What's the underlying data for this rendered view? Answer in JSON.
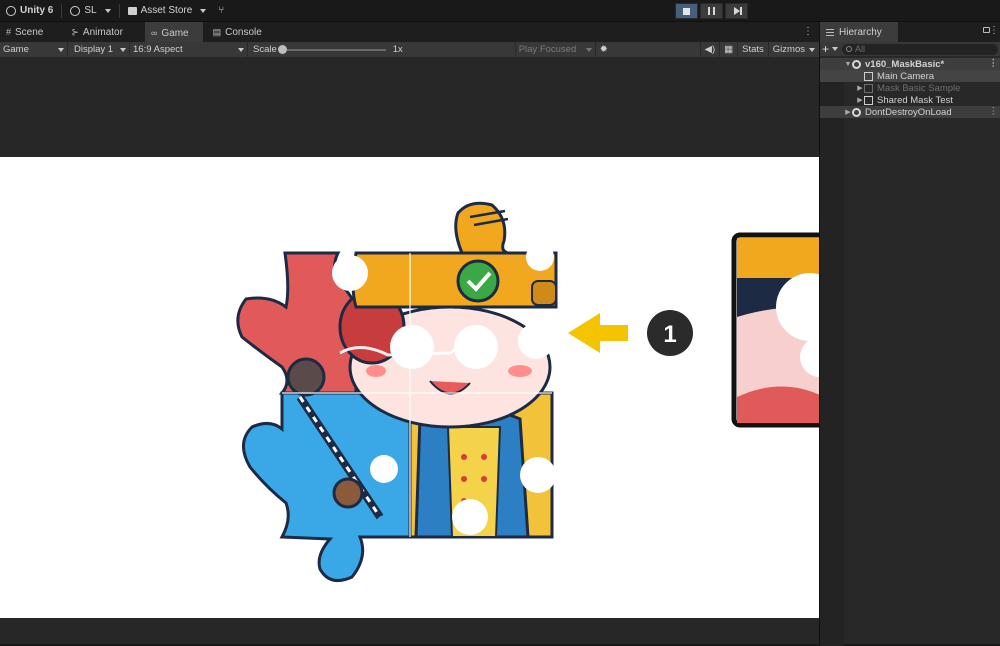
{
  "topbar": {
    "app_name": "Unity 6",
    "account": "SL",
    "asset_store": "Asset Store"
  },
  "tabs": [
    "Scene",
    "Animator",
    "Game",
    "Console"
  ],
  "gamebar": {
    "view_mode": "Game",
    "display": "Display 1",
    "aspect": "16:9 Aspect",
    "scale_label": "Scale",
    "scale_value": "1x",
    "play_focused": "Play Focused",
    "stats": "Stats",
    "gizmos": "Gizmos"
  },
  "callout": {
    "number": "1"
  },
  "hierarchy": {
    "tab_label": "Hierarchy",
    "search_placeholder": "All",
    "items": [
      {
        "label": "v160_MaskBasic*",
        "kind": "scene"
      },
      {
        "label": "Main Camera",
        "kind": "object",
        "selected": true
      },
      {
        "label": "Mask Basic Sample",
        "kind": "object",
        "disabled": true
      },
      {
        "label": "Shared Mask Test",
        "kind": "object"
      },
      {
        "label": "DontDestroyOnLoad",
        "kind": "scene"
      }
    ]
  },
  "colors": {
    "puzzle_red": "#e05a5a",
    "puzzle_blue": "#3aa7e6",
    "puzzle_yellow": "#f2c23a",
    "crown_orange": "#f2a81e",
    "arrow_yellow": "#f5c400",
    "callout_dark": "#2b2b2b"
  }
}
